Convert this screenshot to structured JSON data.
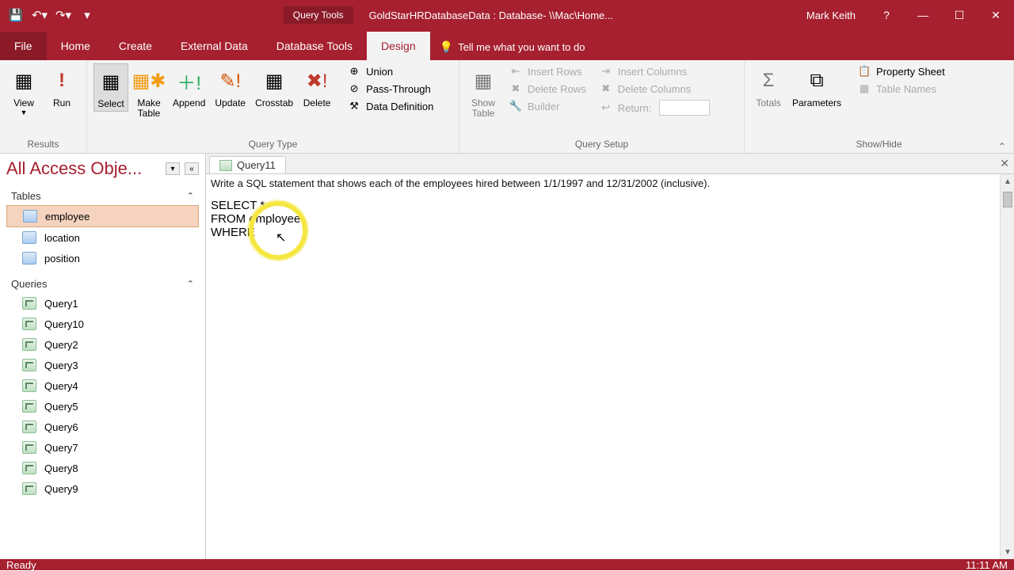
{
  "titlebar": {
    "contextual_label": "Query Tools",
    "db_title": "GoldStarHRDatabaseData : Database- \\\\Mac\\Home...",
    "username": "Mark Keith"
  },
  "tabs": {
    "file": "File",
    "home": "Home",
    "create": "Create",
    "external": "External Data",
    "dbtools": "Database Tools",
    "design": "Design",
    "tellme": "Tell me what you want to do"
  },
  "ribbon": {
    "results": {
      "view": "View",
      "run": "Run",
      "group": "Results"
    },
    "qtype": {
      "select": "Select",
      "maketable": "Make\nTable",
      "append": "Append",
      "update": "Update",
      "crosstab": "Crosstab",
      "delete": "Delete",
      "union": "Union",
      "passthrough": "Pass-Through",
      "datadef": "Data Definition",
      "group": "Query Type"
    },
    "qsetup": {
      "showtable": "Show\nTable",
      "insertrows": "Insert Rows",
      "deleterows": "Delete Rows",
      "builder": "Builder",
      "insertcols": "Insert Columns",
      "deletecols": "Delete Columns",
      "return": "Return:",
      "group": "Query Setup"
    },
    "showhide": {
      "totals": "Totals",
      "parameters": "Parameters",
      "propsheet": "Property Sheet",
      "tablenames": "Table Names",
      "group": "Show/Hide"
    }
  },
  "nav": {
    "title": "All Access Obje...",
    "tables_head": "Tables",
    "tables": [
      "employee",
      "location",
      "position"
    ],
    "queries_head": "Queries",
    "queries": [
      "Query1",
      "Query10",
      "Query2",
      "Query3",
      "Query4",
      "Query5",
      "Query6",
      "Query7",
      "Query8",
      "Query9"
    ]
  },
  "doc": {
    "tab_label": "Query11",
    "comment": "Write a SQL statement that shows each of the employees hired between 1/1/1997 and 12/31/2002 (inclusive).",
    "sql": "SELECT *\nFROM employee\nWHERE"
  },
  "status": {
    "ready": "Ready",
    "time": "11:11 AM"
  }
}
